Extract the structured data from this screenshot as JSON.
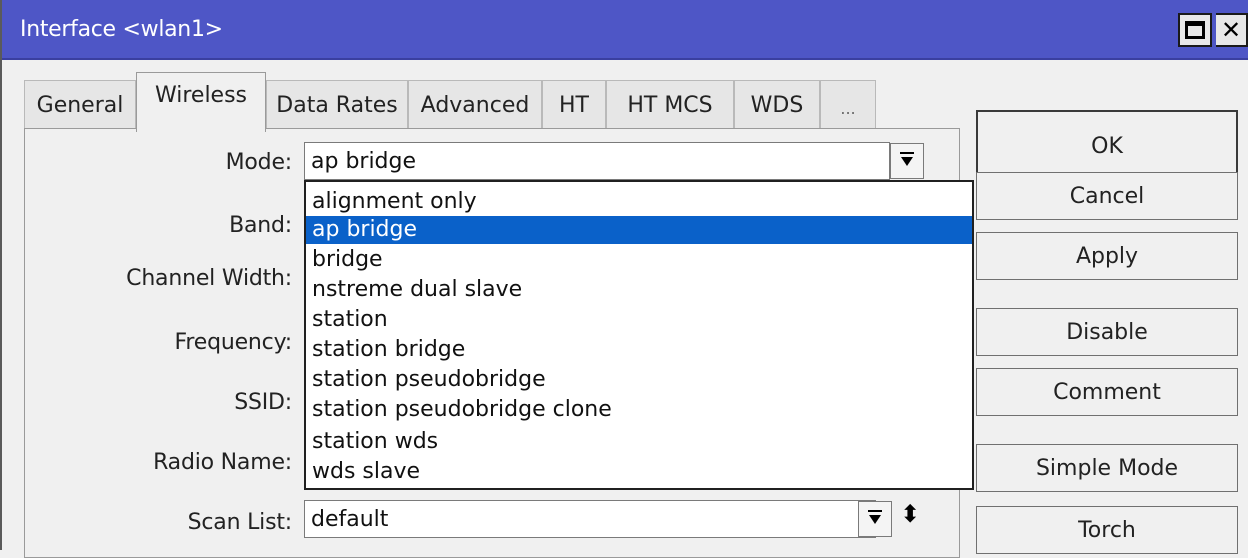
{
  "window": {
    "title": "Interface <wlan1>",
    "maximize_icon": "maximize-icon",
    "close_label": "✕"
  },
  "tabs": [
    {
      "label": "General",
      "active": false
    },
    {
      "label": "Wireless",
      "active": true
    },
    {
      "label": "Data Rates",
      "active": false
    },
    {
      "label": "Advanced",
      "active": false
    },
    {
      "label": "HT",
      "active": false
    },
    {
      "label": "HT MCS",
      "active": false
    },
    {
      "label": "WDS",
      "active": false
    },
    {
      "label": "...",
      "active": false
    }
  ],
  "fields": {
    "mode": {
      "label": "Mode:",
      "value": "ap bridge"
    },
    "band": {
      "label": "Band:"
    },
    "channel_width": {
      "label": "Channel Width:"
    },
    "frequency": {
      "label": "Frequency:"
    },
    "ssid": {
      "label": "SSID:"
    },
    "radio_name": {
      "label": "Radio Name:"
    },
    "scan_list": {
      "label": "Scan List:",
      "value": "default"
    }
  },
  "mode_dropdown": {
    "options": [
      "alignment only",
      "ap bridge",
      "bridge",
      "nstreme dual slave",
      "station",
      "station bridge",
      "station pseudobridge",
      "station pseudobridge clone",
      "station wds",
      "wds slave"
    ],
    "selected": "ap bridge"
  },
  "buttons": {
    "ok": "OK",
    "cancel": "Cancel",
    "apply": "Apply",
    "disable": "Disable",
    "comment": "Comment",
    "simple_mode": "Simple Mode",
    "torch": "Torch"
  },
  "colors": {
    "titlebar": "#4e56c6",
    "selection": "#0a61c9"
  }
}
